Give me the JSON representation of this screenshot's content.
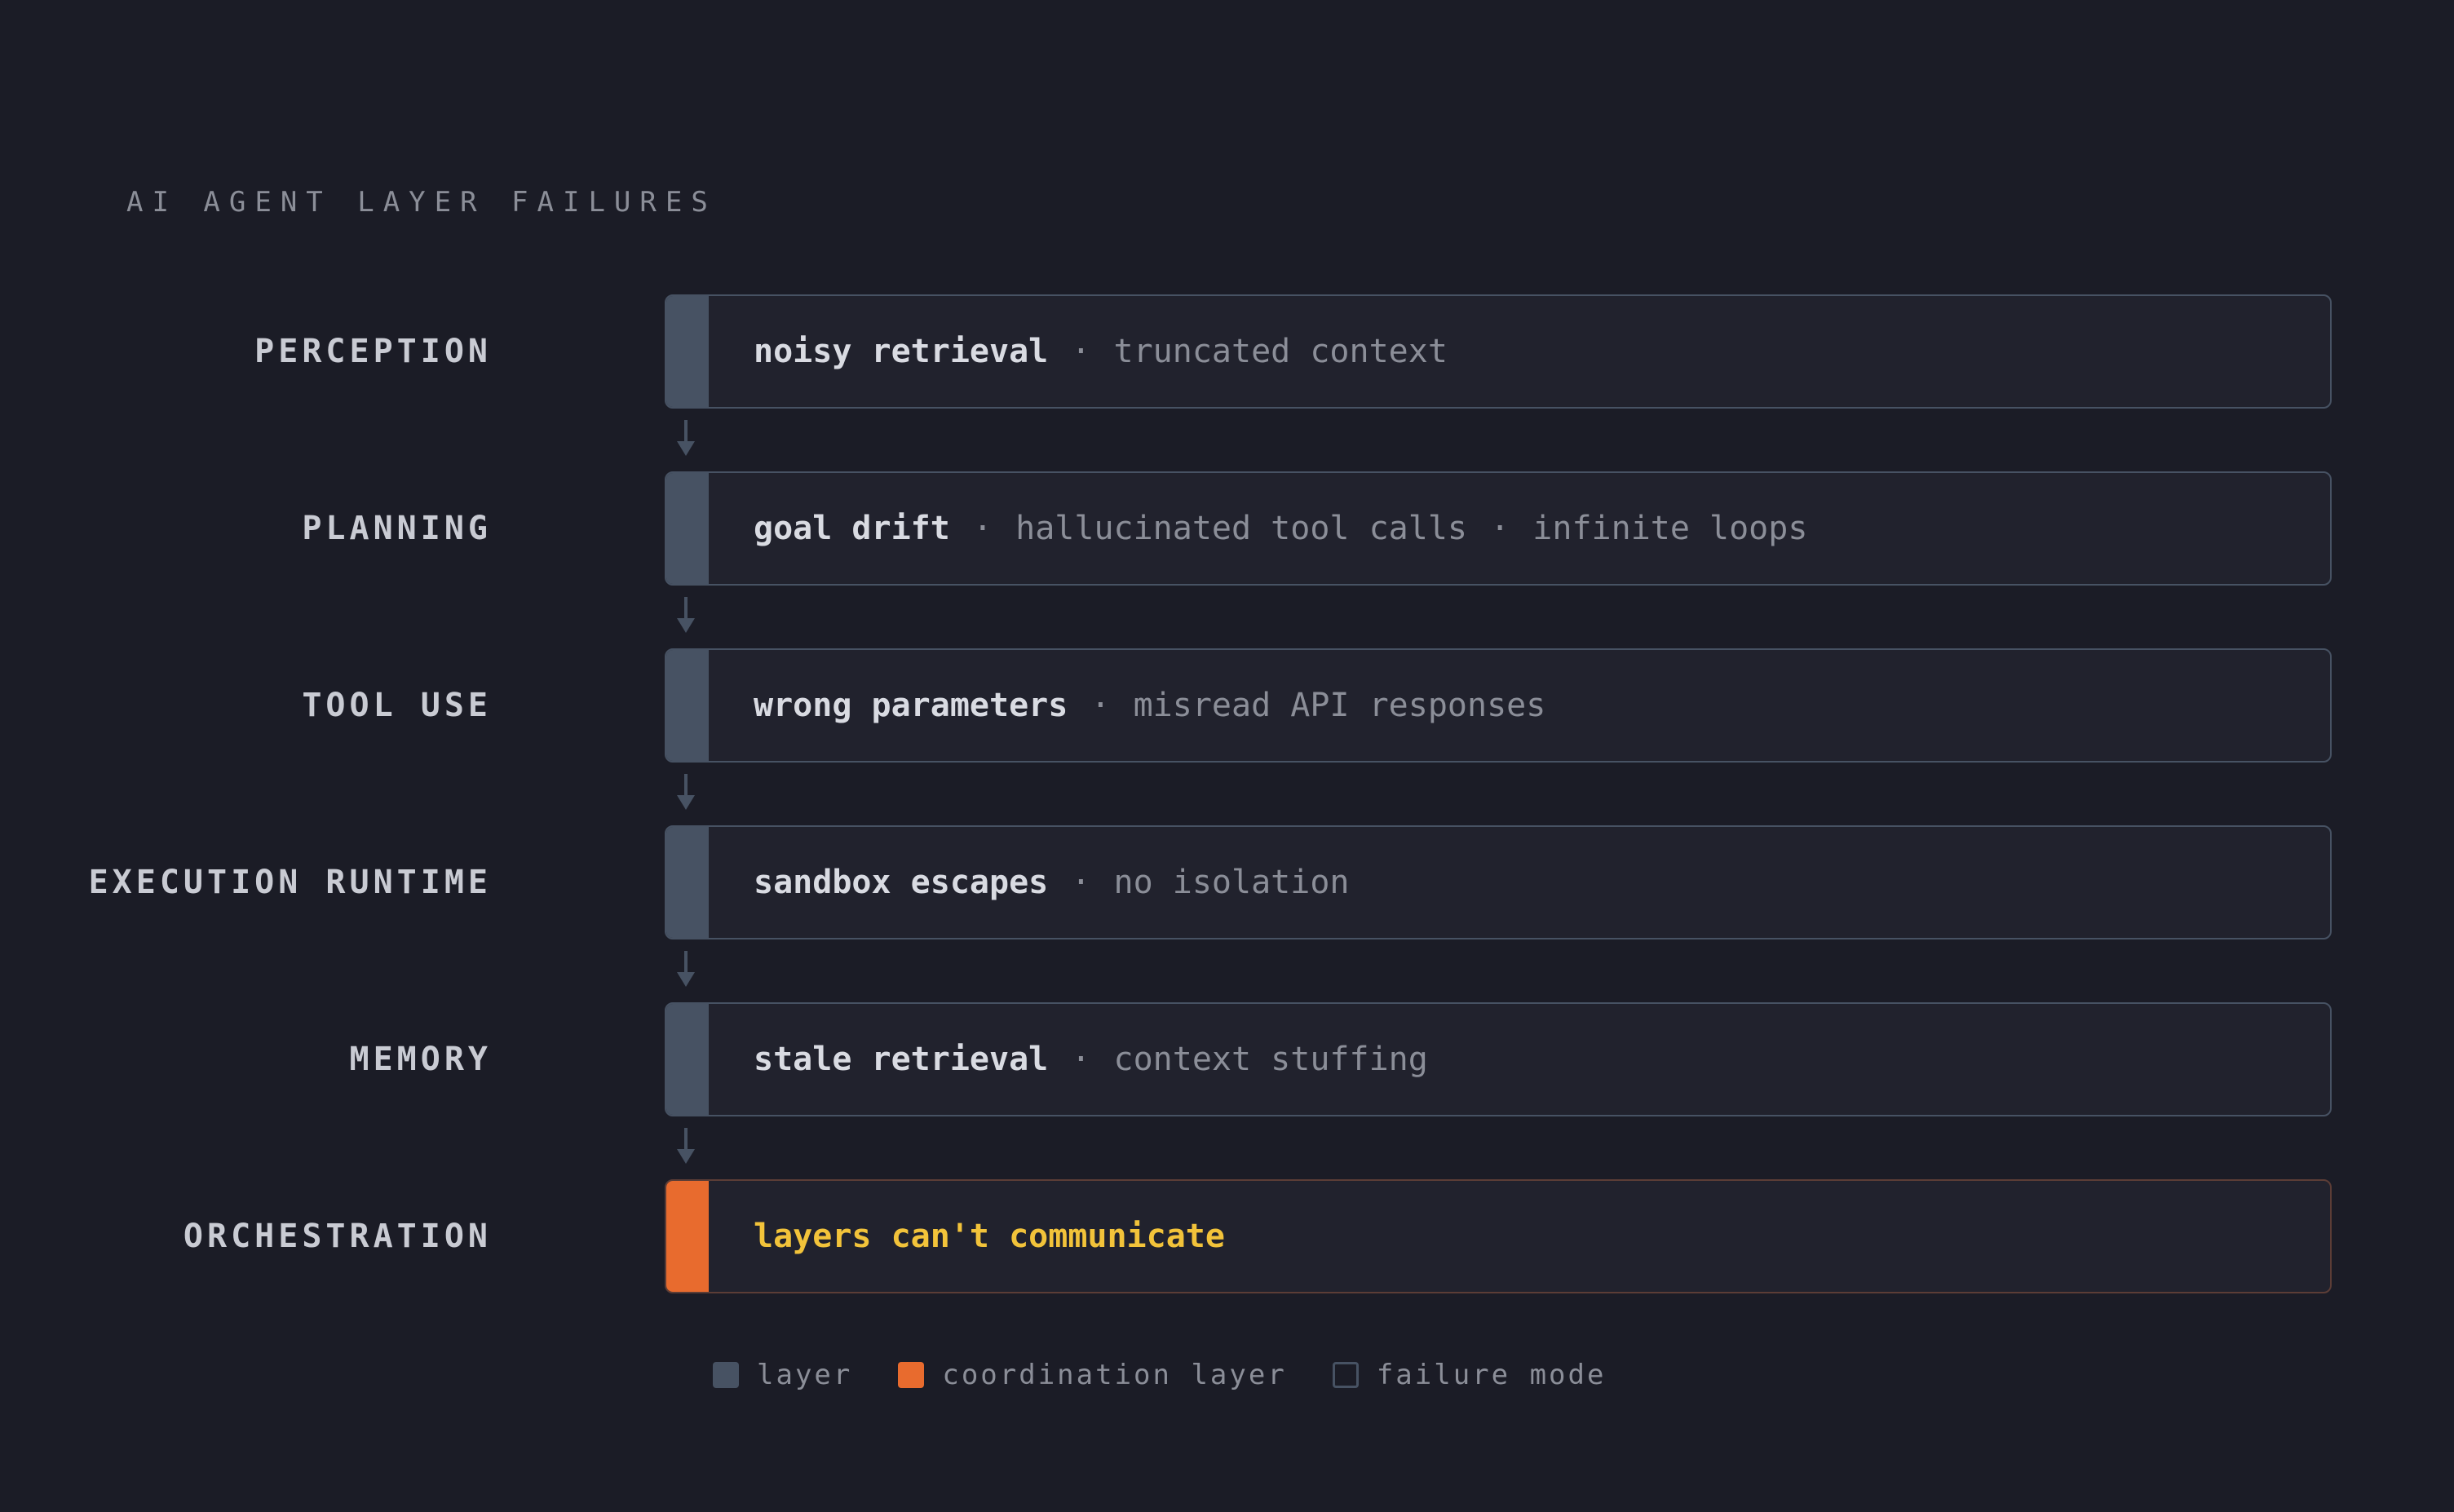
{
  "title": "AI AGENT LAYER FAILURES",
  "colors": {
    "background": "#1b1c26",
    "layer": "#475263",
    "coordination": "#e86b2e",
    "coordination_text": "#f2c33a",
    "box_fill": "#21222d"
  },
  "layers": [
    {
      "label": "PERCEPTION",
      "primary": "noisy retrieval",
      "others": [
        "truncated context"
      ]
    },
    {
      "label": "PLANNING",
      "primary": "goal drift",
      "others": [
        "hallucinated tool calls",
        "infinite loops"
      ]
    },
    {
      "label": "TOOL USE",
      "primary": "wrong parameters",
      "others": [
        "misread API responses"
      ]
    },
    {
      "label": "EXECUTION RUNTIME",
      "primary": "sandbox escapes",
      "others": [
        "no isolation"
      ]
    },
    {
      "label": "MEMORY",
      "primary": "stale retrieval",
      "others": [
        "context stuffing"
      ]
    },
    {
      "label": "ORCHESTRATION",
      "primary": "layers can't communicate",
      "others": []
    }
  ],
  "separator": "·",
  "legend": {
    "layer": "layer",
    "coordination": "coordination layer",
    "failure": "failure mode"
  }
}
